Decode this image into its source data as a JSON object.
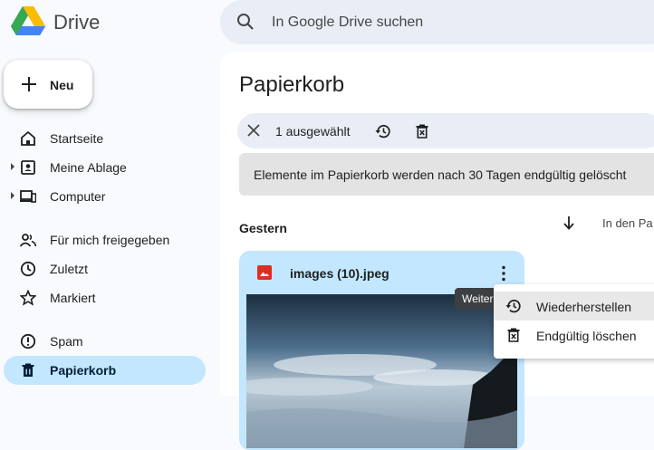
{
  "header": {
    "brand": "Drive",
    "search_placeholder": "In Google Drive suchen"
  },
  "new_button": {
    "label": "Neu"
  },
  "sidebar": {
    "items": [
      {
        "label": "Startseite",
        "icon": "home-icon"
      },
      {
        "label": "Meine Ablage",
        "icon": "my-drive-icon"
      },
      {
        "label": "Computer",
        "icon": "computer-icon"
      },
      {
        "label": "Für mich freigegeben",
        "icon": "shared-icon"
      },
      {
        "label": "Zuletzt",
        "icon": "clock-icon"
      },
      {
        "label": "Markiert",
        "icon": "star-icon"
      },
      {
        "label": "Spam",
        "icon": "spam-icon"
      },
      {
        "label": "Papierkorb",
        "icon": "trash-icon"
      }
    ]
  },
  "main": {
    "title": "Papierkorb",
    "selection": {
      "count_label": "1 ausgewählt"
    },
    "notice": "Elemente im Papierkorb werden nach 30 Tagen endgültig gelöscht",
    "group_label": "Gestern",
    "sort_label": "In den Pa",
    "file": {
      "name": "images (10).jpeg"
    }
  },
  "tooltip": "Weiter",
  "context_menu": {
    "items": [
      {
        "label": "Wiederherstellen",
        "icon": "restore-icon"
      },
      {
        "label": "Endgültig löschen",
        "icon": "delete-forever-icon"
      }
    ]
  },
  "colors": {
    "active_nav": "#c2e7ff",
    "search_bg": "#e9eef6",
    "file_icon": "#d93025"
  }
}
